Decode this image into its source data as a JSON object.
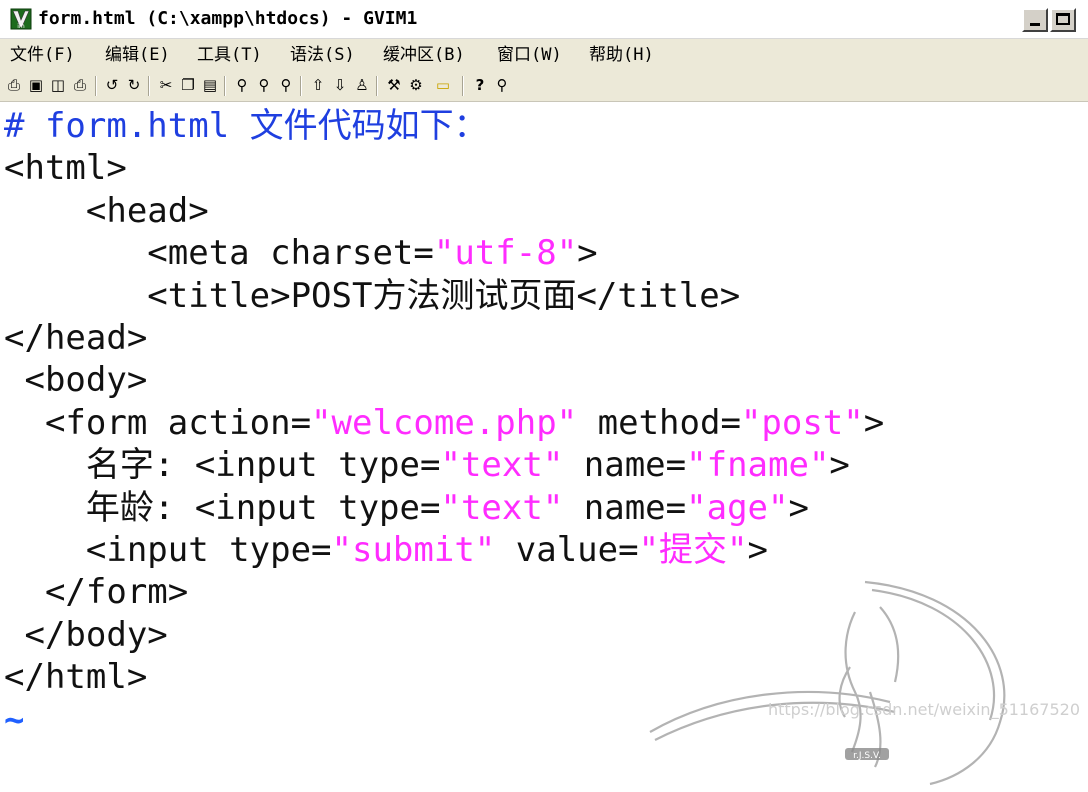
{
  "window": {
    "title": "form.html (C:\\xampp\\htdocs) - GVIM1"
  },
  "menu": {
    "items": [
      "文件(F)",
      "编辑(E)",
      "工具(T)",
      "语法(S)",
      "缓冲区(B)",
      "窗口(W)",
      "帮助(H)"
    ]
  },
  "toolbar": {
    "icons": [
      "open-icon",
      "save-icon",
      "save-all-icon",
      "print-icon",
      "undo-icon",
      "redo-icon",
      "cut-icon",
      "copy-icon",
      "paste-icon",
      "find-replace-icon",
      "find-next-icon",
      "find-prev-icon",
      "load-session-icon",
      "save-session-icon",
      "run-script-icon",
      "make-icon",
      "shell-icon",
      "ctags-icon",
      "help-icon",
      "find-help-icon"
    ]
  },
  "editor": {
    "lines": [
      {
        "segments": [
          {
            "text": "# form.html 文件代码如下：",
            "style": "comment"
          }
        ]
      },
      {
        "segments": [
          {
            "text": "<html>",
            "style": "plain"
          }
        ]
      },
      {
        "segments": [
          {
            "text": "    <head>",
            "style": "plain"
          }
        ]
      },
      {
        "segments": [
          {
            "text": "       <meta charset=",
            "style": "plain"
          },
          {
            "text": "\"utf-8\"",
            "style": "str"
          },
          {
            "text": ">",
            "style": "plain"
          }
        ]
      },
      {
        "segments": [
          {
            "text": "       <title>POST方法测试页面</title>",
            "style": "plain"
          }
        ]
      },
      {
        "segments": [
          {
            "text": "</head>",
            "style": "plain"
          }
        ]
      },
      {
        "segments": [
          {
            "text": " <body>",
            "style": "plain"
          }
        ]
      },
      {
        "segments": [
          {
            "text": "  <form action=",
            "style": "plain"
          },
          {
            "text": "\"welcome.php\"",
            "style": "str"
          },
          {
            "text": " method=",
            "style": "plain"
          },
          {
            "text": "\"post\"",
            "style": "str"
          },
          {
            "text": ">",
            "style": "plain"
          }
        ]
      },
      {
        "segments": [
          {
            "text": "    名字: <input type=",
            "style": "plain"
          },
          {
            "text": "\"text\"",
            "style": "str"
          },
          {
            "text": " name=",
            "style": "plain"
          },
          {
            "text": "\"fname\"",
            "style": "str"
          },
          {
            "text": ">",
            "style": "plain"
          }
        ]
      },
      {
        "segments": [
          {
            "text": "    年龄: <input type=",
            "style": "plain"
          },
          {
            "text": "\"text\"",
            "style": "str"
          },
          {
            "text": " name=",
            "style": "plain"
          },
          {
            "text": "\"age\"",
            "style": "str"
          },
          {
            "text": ">",
            "style": "plain"
          }
        ]
      },
      {
        "segments": [
          {
            "text": "    <input type=",
            "style": "plain"
          },
          {
            "text": "\"submit\"",
            "style": "str"
          },
          {
            "text": " value=",
            "style": "plain"
          },
          {
            "text": "\"提交\"",
            "style": "str"
          },
          {
            "text": ">",
            "style": "plain"
          }
        ]
      },
      {
        "segments": [
          {
            "text": "  </form>",
            "style": "plain"
          }
        ]
      },
      {
        "segments": [
          {
            "text": " </body>",
            "style": "plain"
          }
        ]
      },
      {
        "segments": [
          {
            "text": "</html>",
            "style": "plain"
          }
        ]
      },
      {
        "segments": [
          {
            "text": "~",
            "style": "tilde"
          }
        ]
      }
    ]
  },
  "watermark": {
    "signature": "r.J.S.V.",
    "site": "https://blog.csdn.net/weixin_51167520"
  },
  "colors": {
    "comment": "#1f3fe0",
    "string": "#ff2cff",
    "text": "#111111",
    "tilde": "#2060ff"
  }
}
